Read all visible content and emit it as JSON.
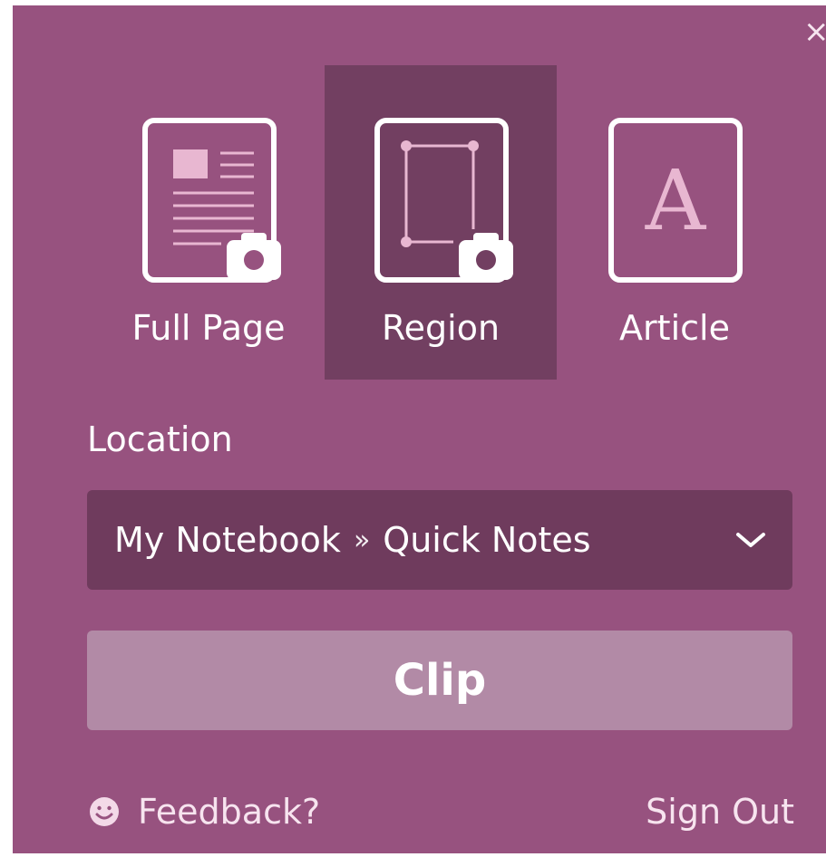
{
  "window": {
    "close_icon": "close-icon"
  },
  "modes": [
    {
      "label": "Full Page",
      "icon": "full-page-icon",
      "selected": false
    },
    {
      "label": "Region",
      "icon": "region-icon",
      "selected": true
    },
    {
      "label": "Article",
      "icon": "article-icon",
      "selected": false
    }
  ],
  "location": {
    "label": "Location",
    "notebook": "My Notebook",
    "separator": "»",
    "section": "Quick Notes"
  },
  "actions": {
    "clip_label": "Clip",
    "feedback_label": "Feedback?",
    "sign_out_label": "Sign Out"
  },
  "colors": {
    "panel_bg": "#97527f",
    "selected_bg": "#723f61",
    "dropdown_bg": "#6f3b5d",
    "clip_bg": "#b28aa6"
  }
}
